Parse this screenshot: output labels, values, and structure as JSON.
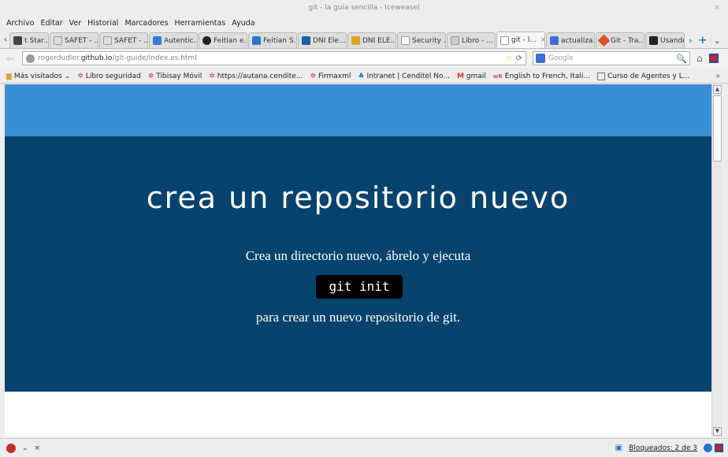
{
  "window": {
    "title": "git - la guía sencilla - Iceweasel",
    "close_glyph": "×"
  },
  "menu": [
    "Archivo",
    "Editar",
    "Ver",
    "Historial",
    "Marcadores",
    "Herramientas",
    "Ayuda"
  ],
  "tabs": [
    {
      "label": "t Star...",
      "favicon_color": "#444444"
    },
    {
      "label": "SAFET - ...",
      "favicon_color": "#dddddd"
    },
    {
      "label": "SAFET - ...",
      "favicon_color": "#dddddd"
    },
    {
      "label": "Autentic...",
      "favicon_color": "#3a78d8"
    },
    {
      "label": "Feitian e...",
      "favicon_color": "#222222"
    },
    {
      "label": "Feitian S...",
      "favicon_color": "#2a78c8"
    },
    {
      "label": "DNI Ele...",
      "favicon_color": "#1a5fa8"
    },
    {
      "label": "DNI ELE...",
      "favicon_color": "#e0a020"
    },
    {
      "label": "Security ...",
      "favicon_color": "#ffffff"
    },
    {
      "label": "Libro - ...",
      "favicon_color": "#cccccc"
    },
    {
      "label": "git - l...",
      "favicon_color": "#ffffff",
      "active": true,
      "close": "×"
    },
    {
      "label": "actualiza...",
      "favicon_color": "#3a6fd8"
    },
    {
      "label": "Git - Tra...",
      "favicon_color": "#e0502a"
    },
    {
      "label": "Usando",
      "favicon_color": "#222222"
    }
  ],
  "tab_tools": {
    "scroll_left": "‹",
    "scroll_right": "›",
    "new_tab": "+",
    "list_all": "⌄"
  },
  "nav": {
    "back": "⇦",
    "url_host": "rogerdudler.",
    "url_domain": "github.io",
    "url_path": "/git-guide/index.es.html",
    "star": "☆",
    "reload": "⟳",
    "search_placeholder": "Google",
    "search_icon": "🔍",
    "home_icon": "⌂"
  },
  "bookmarks": [
    {
      "label": "Más visitados",
      "icon": "folder",
      "dropdown": "⌄"
    },
    {
      "label": "Libro seguridad",
      "icon": "red"
    },
    {
      "label": "Tibisay Móvil",
      "icon": "red"
    },
    {
      "label": "https://autana.cendite...",
      "icon": "red"
    },
    {
      "label": "Firmaxml",
      "icon": "red"
    },
    {
      "label": "Intranet | Cenditel No...",
      "icon": "blue"
    },
    {
      "label": "gmail",
      "icon": "gmail"
    },
    {
      "label": "English to French, Itali...",
      "icon": "wr"
    },
    {
      "label": "Curso de Agentes y L...",
      "icon": "box"
    }
  ],
  "bookmarks_more": "»",
  "page": {
    "headline": "crea un repositorio nuevo",
    "paragraph_before": "Crea un directorio nuevo, ábrelo y ejecuta",
    "command": "git init",
    "paragraph_after": "para crear un nuevo repositorio de git.",
    "colors": {
      "top_band": "#3a8fd4",
      "main_band": "#08436e",
      "code_bg": "#000000"
    }
  },
  "status": {
    "blocked_label": "Bloqueados: 2 de 3",
    "abp_close": "×",
    "abp_dropdown": "⌄"
  },
  "scrollbar": {
    "up": "▲",
    "down": "▼"
  }
}
